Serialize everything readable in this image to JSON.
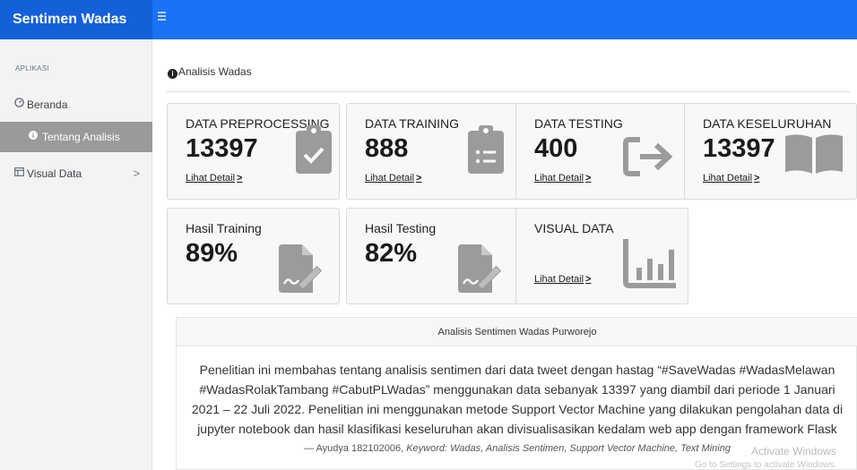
{
  "app": {
    "brand": "Sentimen Wadas"
  },
  "sidebar": {
    "header": "APLIKASI",
    "items": [
      {
        "label": "Beranda",
        "icon": "dashboard-icon"
      },
      {
        "label": "Tentang Analisis",
        "icon": "info-icon",
        "active": true
      },
      {
        "label": "Visual Data",
        "icon": "table-icon",
        "chevron": ">"
      }
    ]
  },
  "breadcrumb": {
    "icon": "info-icon",
    "label": "Analisis Wadas"
  },
  "cards": [
    {
      "title": "DATA PREPROCESSING",
      "value": "13397",
      "link": "Lihat Detail",
      "icon": "clipboard-check-icon"
    },
    {
      "title": "DATA TRAINING",
      "value": "888",
      "link": "Lihat Detail",
      "icon": "clipboard-list-icon"
    },
    {
      "title": "DATA TESTING",
      "value": "400",
      "link": "Lihat Detail",
      "icon": "sign-out-icon"
    },
    {
      "title": "DATA KESELURUHAN",
      "value": "13397",
      "link": "Lihat Detail",
      "icon": "book-open-icon"
    },
    {
      "title": "Hasil Training",
      "value": "89%",
      "icon": "file-signature-icon"
    },
    {
      "title": "Hasil Testing",
      "value": "82%",
      "icon": "file-signature-icon"
    },
    {
      "title": "VISUAL DATA",
      "link": "Lihat Detail",
      "icon": "bar-chart-icon"
    }
  ],
  "panel": {
    "header": "Analisis Sentimen Wadas Purworejo",
    "body": "Penelitian ini membahas tentang analisis sentimen dari data tweet dengan hastag “#SaveWadas #WadasMelawan #WadasRolakTambang #CabutPLWadas” menggunakan data sebanyak 13397 yang diambil dari periode 1 Januari 2021 – 22 Juli 2022. Penelitian ini menggunakan metode Support Vector Machine yang dilakukan pengolahan data di jupyter notebook dan hasil klasifikasi keseluruhan akan divisualisasikan kedalam web app dengan framework Flask",
    "footer_author": "— Ayudya 182102006, ",
    "footer_keywords": "Keyword: Wadas, Analisis Sentimen, Support Vector Machine, Text Mining"
  },
  "watermark": {
    "line1": "Activate Windows",
    "line2": "Go to Settings to activate Windows."
  },
  "colors": {
    "topbar": "#1a73f5",
    "brand_bg": "#1460d8",
    "sidebar_active": "#9a9a9a",
    "icon_gray": "#9b9b9b"
  }
}
